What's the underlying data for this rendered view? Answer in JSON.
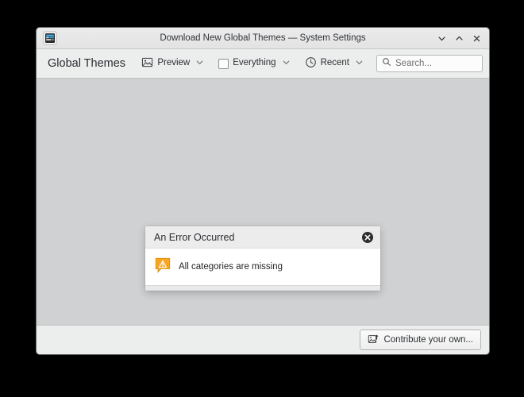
{
  "window": {
    "app_icon": "system-settings-icon",
    "title": "Download New Global Themes — System Settings",
    "controls": [
      {
        "name": "minimize",
        "icon": "chevron-down-icon"
      },
      {
        "name": "maximize",
        "icon": "chevron-up-icon"
      },
      {
        "name": "close",
        "icon": "close-x-icon"
      }
    ]
  },
  "toolbar": {
    "page_title": "Global Themes",
    "preview": {
      "label": "Preview",
      "icon": "image-preview-icon",
      "dropdown_icon": "chevron-down-icon"
    },
    "everything": {
      "label": "Everything",
      "icon": "checkbox-unchecked-icon",
      "dropdown_icon": "chevron-down-icon"
    },
    "recent": {
      "label": "Recent",
      "icon": "clock-icon",
      "dropdown_icon": "chevron-down-icon"
    },
    "search": {
      "placeholder": "Search...",
      "value": "",
      "icon": "search-icon"
    }
  },
  "dialog": {
    "title": "An Error Occurred",
    "close_icon": "close-circle-icon",
    "message": "All categories are missing",
    "message_icon": "warning-bubble-icon"
  },
  "bottombar": {
    "contribute": {
      "label": "Contribute your own...",
      "icon": "upload-image-icon"
    }
  },
  "colors": {
    "desktop_background": "#000000",
    "window_background": "#d0d2d4",
    "content_background": "#cfd1d3",
    "toolbar_background": "#eceded",
    "dialog_body": "#ffffff",
    "warning_accent": "#f5a623"
  }
}
